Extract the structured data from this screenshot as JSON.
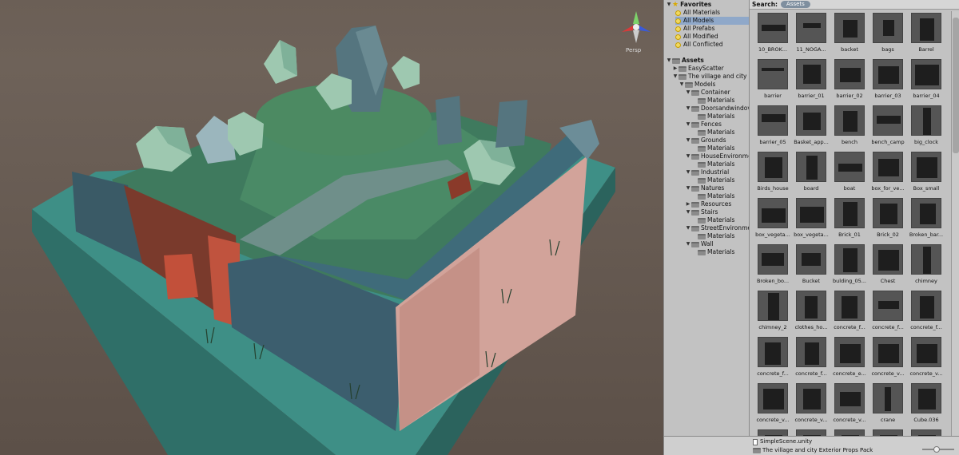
{
  "scene": {
    "view_mode_label": "Persp"
  },
  "hierarchy": {
    "favorites_label": "Favorites",
    "favorites": [
      "All Materials",
      "All Models",
      "All Prefabs",
      "All Modified",
      "All Conflicted"
    ],
    "selected_favorite": "All Models",
    "assets_label": "Assets",
    "folders": [
      {
        "label": "EasyScatter",
        "depth": 1,
        "open": false
      },
      {
        "label": "The village and city E",
        "depth": 1,
        "open": true
      },
      {
        "label": "Models",
        "depth": 2,
        "open": true
      },
      {
        "label": "Container",
        "depth": 3,
        "open": true
      },
      {
        "label": "Materials",
        "depth": 4,
        "open": false
      },
      {
        "label": "Doorsandwindov",
        "depth": 3,
        "open": true
      },
      {
        "label": "Materials",
        "depth": 4,
        "open": false
      },
      {
        "label": "Fences",
        "depth": 3,
        "open": true
      },
      {
        "label": "Materials",
        "depth": 4,
        "open": false
      },
      {
        "label": "Grounds",
        "depth": 3,
        "open": true
      },
      {
        "label": "Materials",
        "depth": 4,
        "open": false
      },
      {
        "label": "HouseEnvironme",
        "depth": 3,
        "open": true
      },
      {
        "label": "Materials",
        "depth": 4,
        "open": false
      },
      {
        "label": "Industrial",
        "depth": 3,
        "open": true
      },
      {
        "label": "Materials",
        "depth": 4,
        "open": false
      },
      {
        "label": "Natures",
        "depth": 3,
        "open": true
      },
      {
        "label": "Materials",
        "depth": 4,
        "open": false
      },
      {
        "label": "Resources",
        "depth": 3,
        "open": false
      },
      {
        "label": "Stairs",
        "depth": 3,
        "open": true
      },
      {
        "label": "Materials",
        "depth": 4,
        "open": false
      },
      {
        "label": "StreetEnvironme",
        "depth": 3,
        "open": true
      },
      {
        "label": "Materials",
        "depth": 4,
        "open": false
      },
      {
        "label": "Wall",
        "depth": 3,
        "open": true
      },
      {
        "label": "Materials",
        "depth": 4,
        "open": false
      }
    ]
  },
  "assets": {
    "search_label": "Search:",
    "search_chip": "Assets",
    "items": [
      "10_BROK...",
      "11_NOGA...",
      "backet",
      "bags",
      "Barrel",
      "barrier",
      "barrier_01",
      "barrier_02",
      "barrier_03",
      "barrier_04",
      "barrier_05",
      "Basket_app...",
      "bench",
      "bench_camp",
      "big_clock",
      "Birds_house",
      "board",
      "boat",
      "box_for_ve...",
      "Box_small",
      "box_vegeta...",
      "box_vegeta...",
      "Brick_01",
      "Brick_02",
      "Broken_bar...",
      "Broken_bo...",
      "Bucket",
      "bulding_05...",
      "Chest",
      "chimney",
      "chimney_2",
      "clothes_ho...",
      "concrete_f...",
      "concrete_f...",
      "concrete_f...",
      "concrete_f...",
      "concrete_f...",
      "concrete_e...",
      "concrete_v...",
      "concrete_v...",
      "concrete_v...",
      "concrete_v...",
      "concrete_v...",
      "crane",
      "Cube.036",
      "",
      "",
      "",
      "",
      ""
    ]
  },
  "footer": {
    "scene_file": "SimpleScene.unity",
    "package_path": "The village and city Exterior  Props Pack"
  }
}
